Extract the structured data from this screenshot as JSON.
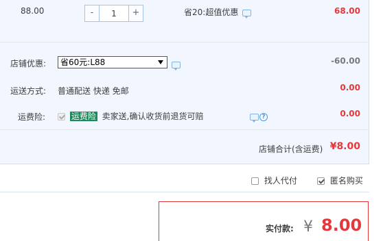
{
  "item": {
    "price": "88.00",
    "quantity": "1",
    "minus_label": "-",
    "plus_label": "+",
    "promo_text": "省20:超值优惠",
    "subtotal": "68.00"
  },
  "shop_discount": {
    "label": "店铺优惠:",
    "selected_option": "省60元:L88",
    "amount": "-60.00"
  },
  "shipping": {
    "label": "运送方式:",
    "method": "普通配送 快递 免邮",
    "amount": "0.00"
  },
  "insurance": {
    "label": "运费险:",
    "tag": "运费险",
    "description": "卖家送,确认收货前退货可赔",
    "amount": "0.00",
    "help_glyph": "?"
  },
  "shop_total": {
    "label": "店铺合计(含运费)",
    "amount": "¥8.00"
  },
  "options": {
    "proxy_pay_label": "找人代付",
    "anonymous_label": "匿名购买",
    "anonymous_checked": true,
    "proxy_pay_checked": false
  },
  "payment": {
    "label": "实付款:",
    "currency": "¥",
    "amount": "8.00"
  },
  "icons": [
    "chat-icon",
    "help-icon",
    "dropdown-arrow-icon",
    "checkbox-icon"
  ],
  "colors": {
    "accent_red": "#e4393c",
    "panel_bg": "#f2f7ff",
    "tag_green": "#1a8a5a",
    "link_blue": "#4b9be0"
  }
}
